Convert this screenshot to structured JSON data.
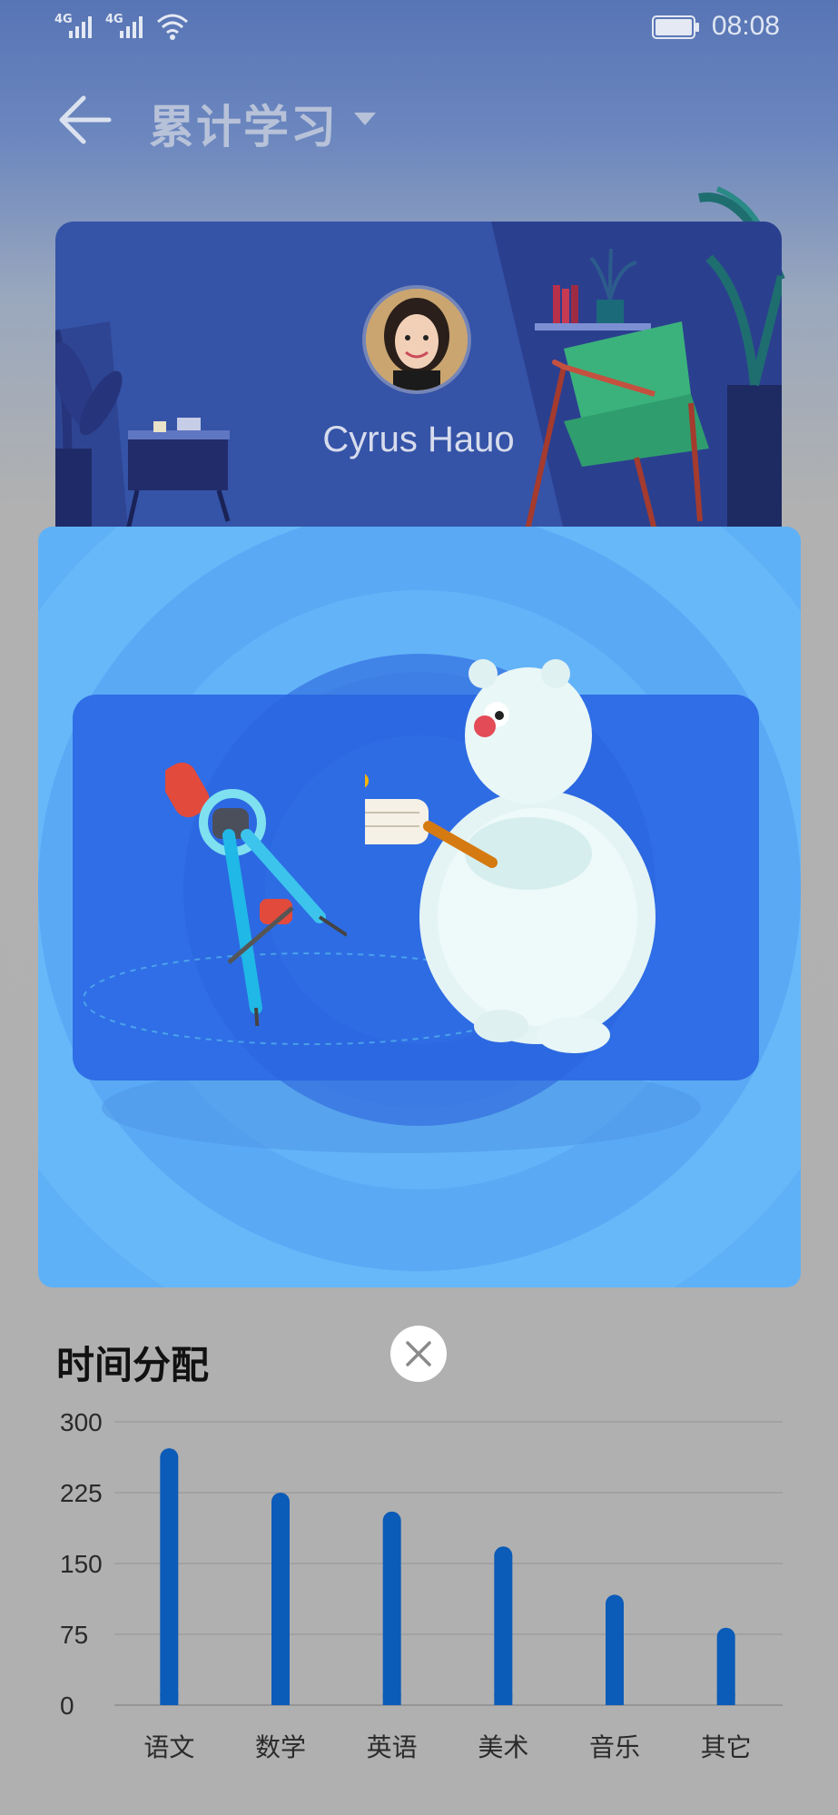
{
  "status_bar": {
    "signal1": "4G",
    "signal2": "4G",
    "time": "08:08"
  },
  "header": {
    "title": "累计学习"
  },
  "profile": {
    "name": "Cyrus Hauo"
  },
  "chart_section": {
    "title": "时间分配"
  },
  "colors": {
    "bar": "#0b5bb8",
    "modal_bg": "#5fb1f7",
    "profile_bg": "#3553a7"
  },
  "chart_data": {
    "type": "bar",
    "categories": [
      "语文",
      "数学",
      "英语",
      "美术",
      "音乐",
      "其它"
    ],
    "values": [
      272,
      225,
      205,
      168,
      117,
      82
    ],
    "yticks": [
      "300",
      "225",
      "150",
      "75",
      "0"
    ],
    "ylim": [
      0,
      300
    ],
    "title": "时间分配",
    "grid": true
  }
}
